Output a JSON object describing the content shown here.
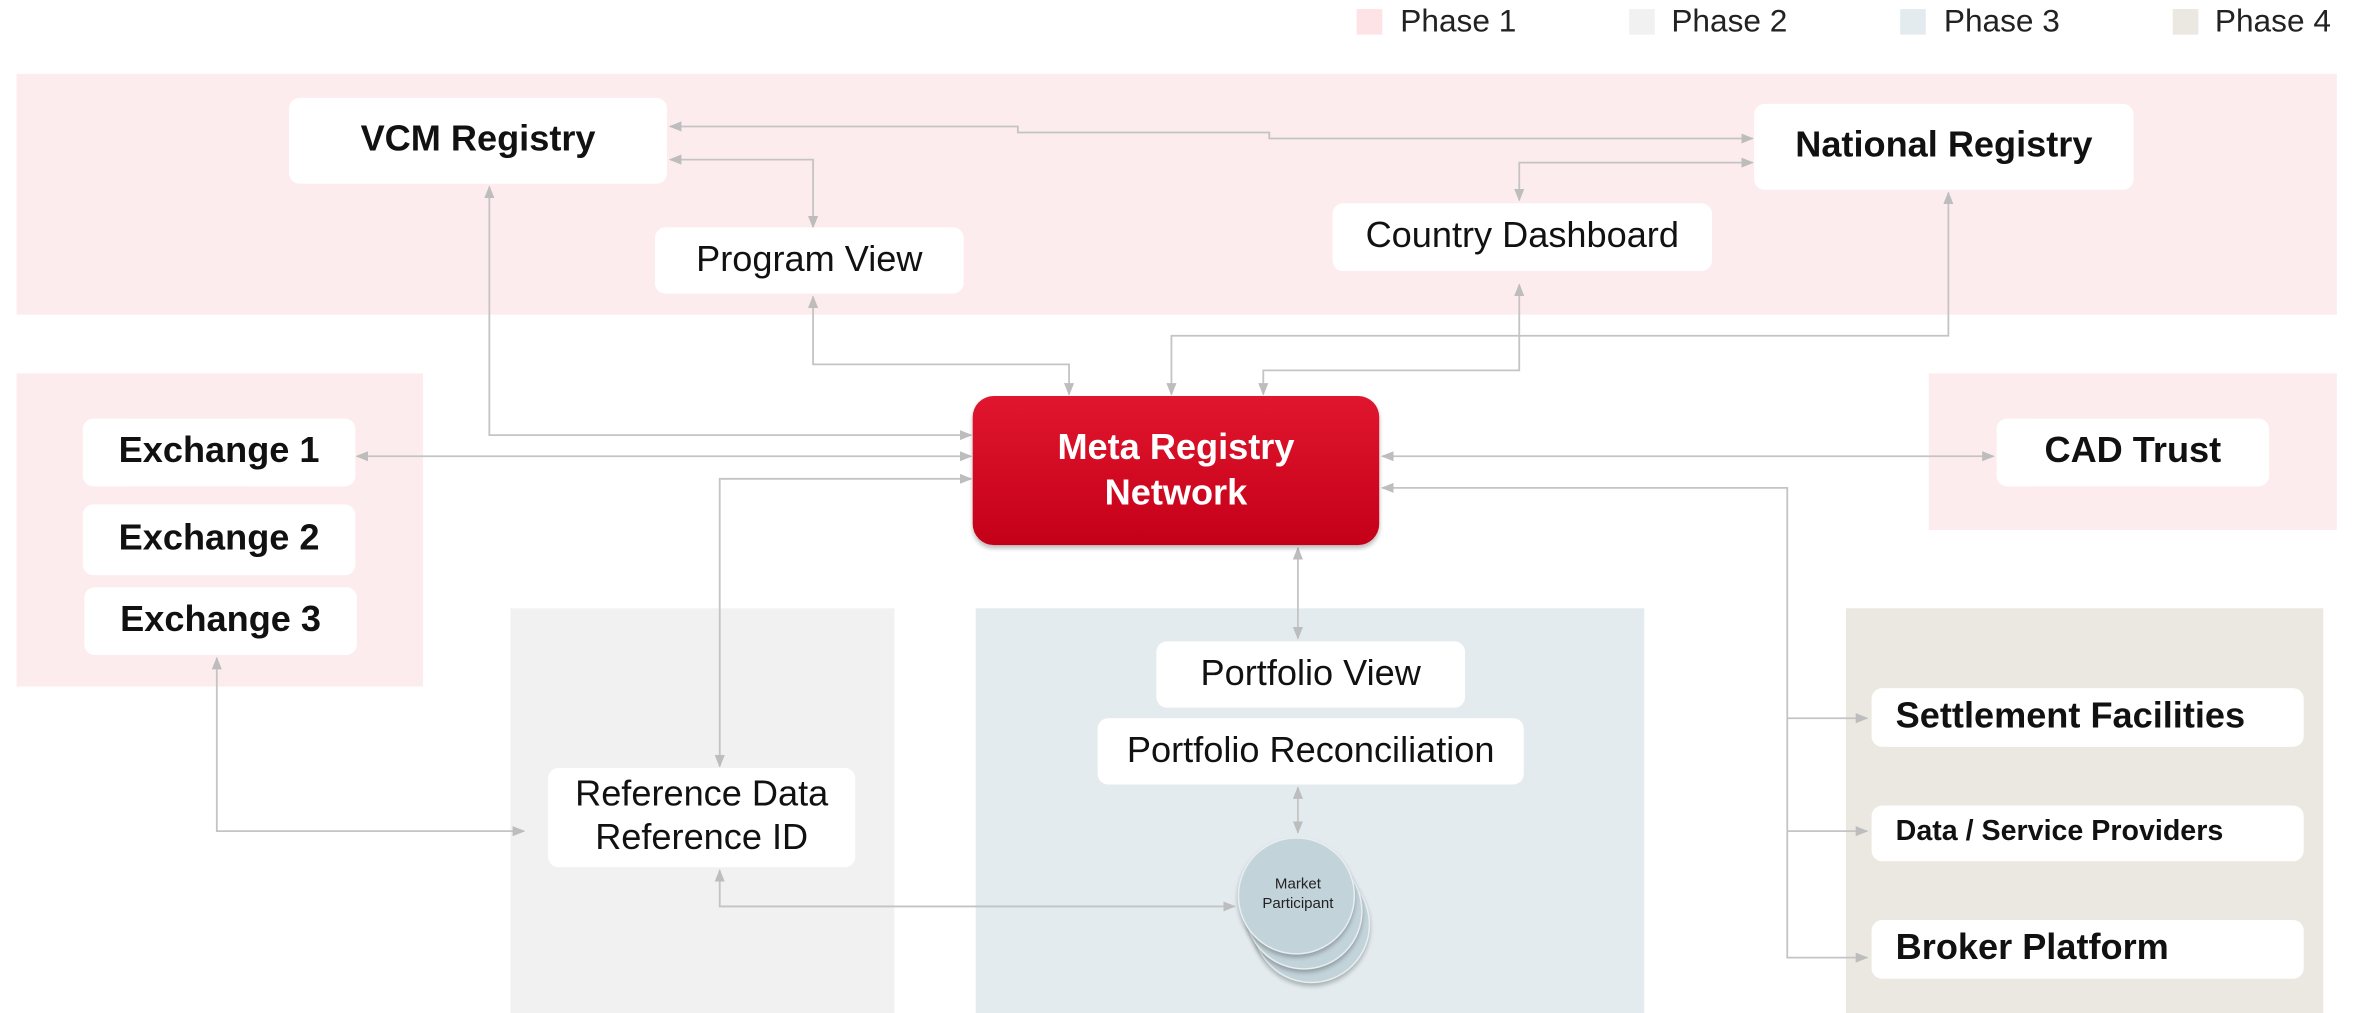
{
  "legend": [
    {
      "label": "Phase 1",
      "color": "#fde3e6"
    },
    {
      "label": "Phase 2",
      "color": "#f1f1f1"
    },
    {
      "label": "Phase 3",
      "color": "#e3ebef"
    },
    {
      "label": "Phase 4",
      "color": "#ebe7e1"
    }
  ],
  "hub": {
    "line1": "Meta Registry",
    "line2": "Network"
  },
  "nodes": {
    "vcm_registry": "VCM Registry",
    "national_registry": "National Registry",
    "program_view": "Program View",
    "country_dashboard": "Country Dashboard",
    "exchange_1": "Exchange 1",
    "exchange_2": "Exchange 2",
    "exchange_3": "Exchange 3",
    "cad_trust": "CAD Trust",
    "portfolio_view": "Portfolio View",
    "portfolio_reconciliation": "Portfolio Reconciliation",
    "reference_data_line1": "Reference Data",
    "reference_data_line2": "Reference ID",
    "market_participant_line1": "Market",
    "market_participant_line2": "Participant",
    "settlement_facilities": "Settlement Facilities",
    "data_service_providers": "Data / Service Providers",
    "broker_platform": "Broker Platform"
  }
}
